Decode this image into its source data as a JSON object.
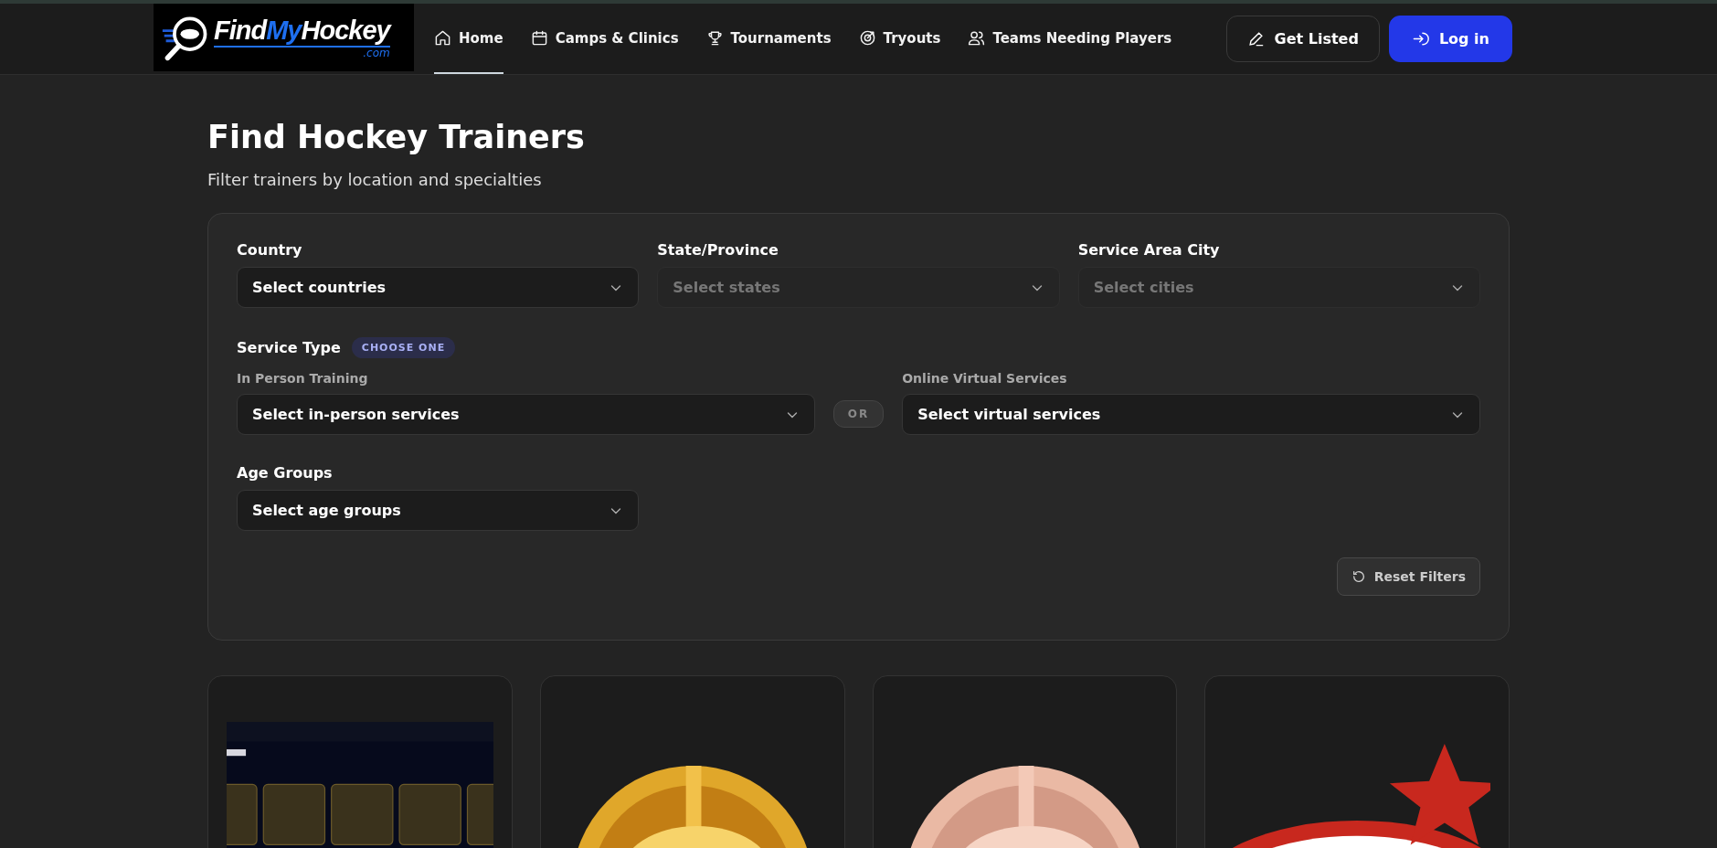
{
  "logo": {
    "name_parts": [
      "Find",
      "My",
      "Hockey"
    ],
    "domain": ".com"
  },
  "nav": [
    {
      "label": "Home",
      "selected": true
    },
    {
      "label": "Camps & Clinics",
      "selected": false
    },
    {
      "label": "Tournaments",
      "selected": false
    },
    {
      "label": "Tryouts",
      "selected": false
    },
    {
      "label": "Teams Needing Players",
      "selected": false
    }
  ],
  "actions": [
    {
      "label": "Get Listed",
      "kind": "outline"
    },
    {
      "label": "Log in",
      "kind": "primary"
    }
  ],
  "page": {
    "title": "Find Hockey Trainers",
    "subtitle": "Filter trainers by location and specialties"
  },
  "filters": {
    "location": [
      {
        "label": "Country",
        "placeholder": "Select countries",
        "disabled": false
      },
      {
        "label": "State/Province",
        "placeholder": "Select states",
        "disabled": true
      },
      {
        "label": "Service Area City",
        "placeholder": "Select cities",
        "disabled": true
      }
    ],
    "service_type": {
      "label": "Service Type",
      "badge": "CHOOSE ONE",
      "separator": "OR",
      "options": [
        {
          "label": "In Person Training",
          "placeholder": "Select in-person services",
          "disabled": false
        },
        {
          "label": "Online Virtual Services",
          "placeholder": "Select virtual services",
          "disabled": false
        }
      ]
    },
    "age_groups": {
      "label": "Age Groups",
      "placeholder": "Select age groups",
      "disabled": false
    },
    "reset_button": "Reset Filters"
  }
}
